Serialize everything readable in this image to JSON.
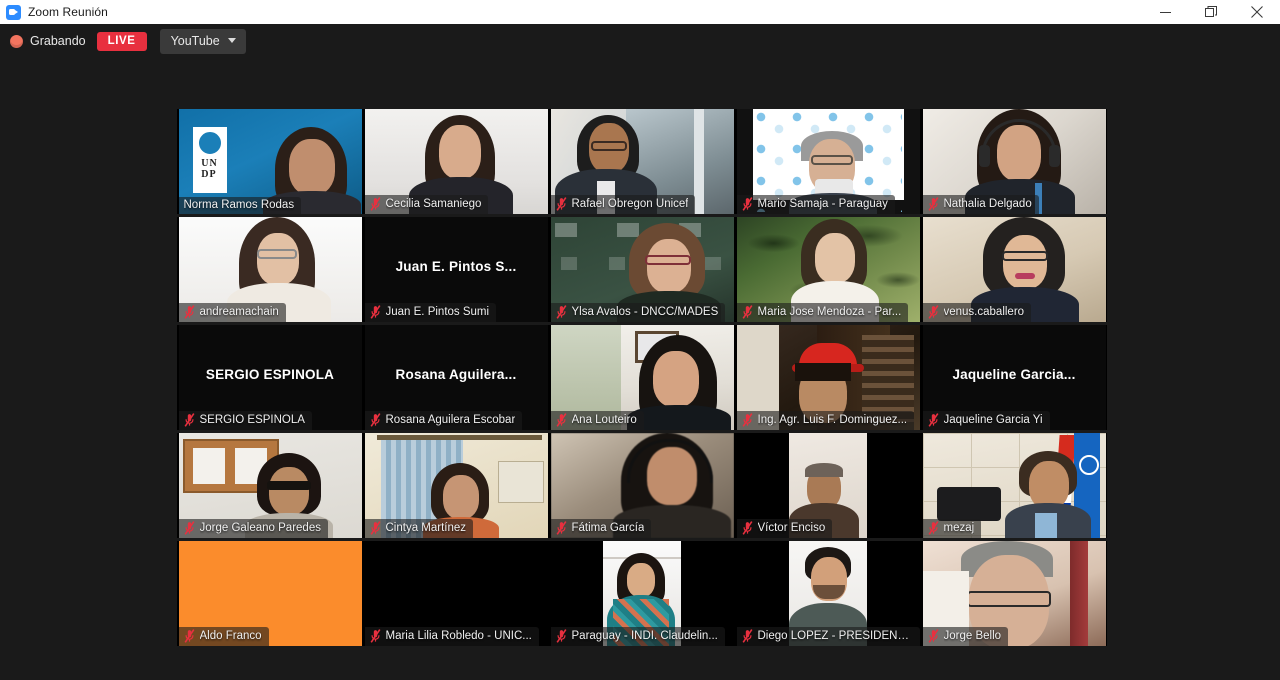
{
  "window": {
    "title": "Zoom Reunión",
    "app_icon": "zoom-camera-icon",
    "controls": {
      "minimize": "minimize-icon",
      "restore": "restore-icon",
      "close": "close-icon"
    }
  },
  "recording_bar": {
    "status_label": "Grabando",
    "live_badge": "LIVE",
    "platform": "YouTube",
    "dropdown_icon": "chevron-down-icon",
    "dot_color": "#f2745f",
    "live_color": "#e8303f"
  },
  "gallery": {
    "active_speaker_border_color": "#9ee84a",
    "columns": 5,
    "rows": 5,
    "participants": [
      {
        "name": "Norma Ramos Rodas",
        "muted": false,
        "video": true,
        "active": true,
        "bg": "bg-undp",
        "display": "video"
      },
      {
        "name": "Cecilia Samaniego",
        "muted": true,
        "video": true,
        "active": false,
        "bg": "bg-white",
        "display": "video"
      },
      {
        "name": "Rafael Obregon Unicef",
        "muted": true,
        "video": true,
        "active": false,
        "bg": "bg-office",
        "display": "video"
      },
      {
        "name": "Mario Samaja - Paraguay",
        "muted": true,
        "video": true,
        "active": false,
        "bg": "bg-unpattern",
        "display": "video"
      },
      {
        "name": "Nathalia Delgado",
        "muted": true,
        "video": true,
        "active": false,
        "bg": "bg-lanyard",
        "display": "video"
      },
      {
        "name": "andreamachain",
        "muted": true,
        "video": true,
        "active": false,
        "bg": "bg-whiteroom",
        "display": "video"
      },
      {
        "name": "Juan E. Pintos Sumi",
        "muted": true,
        "video": false,
        "active": false,
        "bg": "bg-black",
        "display": "name",
        "big_name": "Juan E. Pintos S..."
      },
      {
        "name": "Ylsa Avalos - DNCC/MADES",
        "muted": true,
        "video": true,
        "active": false,
        "bg": "bg-greenboard",
        "display": "video"
      },
      {
        "name": "Maria Jose Mendoza - Par...",
        "muted": true,
        "video": true,
        "active": false,
        "bg": "bg-jungle",
        "display": "video"
      },
      {
        "name": "venus.caballero",
        "muted": true,
        "video": true,
        "active": false,
        "bg": "bg-cream",
        "display": "video"
      },
      {
        "name": "SERGIO ESPINOLA",
        "muted": true,
        "video": false,
        "active": false,
        "bg": "bg-black",
        "display": "name",
        "big_name": "SERGIO ESPINOLA"
      },
      {
        "name": "Rosana Aguilera Escobar",
        "muted": true,
        "video": false,
        "active": false,
        "bg": "bg-black",
        "display": "name",
        "big_name": "Rosana  Aguilera..."
      },
      {
        "name": "Ana Louteiro",
        "muted": true,
        "video": true,
        "active": false,
        "bg": "bg-room",
        "display": "video"
      },
      {
        "name": "Ing. Agr. Luis F. Dominguez...",
        "muted": true,
        "video": true,
        "active": false,
        "bg": "bg-darkroom",
        "display": "video"
      },
      {
        "name": "Jaqueline Garcia Yi",
        "muted": true,
        "video": false,
        "active": false,
        "bg": "bg-black",
        "display": "name",
        "big_name": "Jaqueline  Garcia..."
      },
      {
        "name": "Jorge Galeano Paredes",
        "muted": true,
        "video": true,
        "active": false,
        "bg": "bg-cork",
        "display": "video"
      },
      {
        "name": "Cintya Martínez",
        "muted": true,
        "video": true,
        "active": false,
        "bg": "bg-curtain",
        "display": "video"
      },
      {
        "name": "Fátima García",
        "muted": true,
        "video": true,
        "active": false,
        "bg": "bg-blur",
        "display": "video"
      },
      {
        "name": "Víctor Enciso",
        "muted": true,
        "video": true,
        "active": false,
        "bg": "bg-plainwall",
        "display": "video-narrow"
      },
      {
        "name": "mezaj",
        "muted": true,
        "video": true,
        "active": false,
        "bg": "bg-tiles",
        "display": "video"
      },
      {
        "name": "Aldo Franco",
        "muted": true,
        "video": true,
        "active": false,
        "bg": "bg-orange",
        "display": "video"
      },
      {
        "name": "Maria Lilia Robledo - UNIC...",
        "muted": true,
        "video": false,
        "active": false,
        "bg": "bg-black",
        "display": "blank"
      },
      {
        "name": "Paraguay - INDI. Claudelin...",
        "muted": true,
        "video": true,
        "active": false,
        "bg": "bg-whiteroom",
        "display": "video-narrow"
      },
      {
        "name": "Diego LOPEZ - PRESIDENT...",
        "muted": true,
        "video": true,
        "active": false,
        "bg": "bg-whiteroom",
        "display": "video-narrow"
      },
      {
        "name": "Jorge Bello",
        "muted": true,
        "video": true,
        "active": false,
        "bg": "bg-warm",
        "display": "video"
      }
    ]
  }
}
